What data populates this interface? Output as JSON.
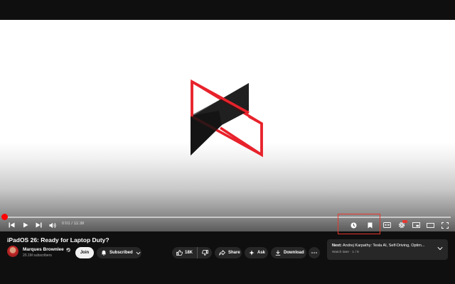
{
  "player": {
    "time_display": "0:01 / 11:38",
    "progress_fraction": 0.005,
    "colors": {
      "accent": "#ff0000",
      "highlight_box": "#e5372b",
      "background": "#0f0f0f"
    },
    "icons": [
      "previous-icon",
      "play-icon",
      "next-icon",
      "volume-icon",
      "watch-later-icon",
      "save-icon",
      "captions-icon",
      "settings-icon",
      "miniplayer-icon",
      "theater-icon",
      "fullscreen-icon"
    ]
  },
  "video": {
    "title": "iPadOS 26: Ready for Laptop Duty?"
  },
  "channel": {
    "name": "Marques Brownlee",
    "subscribers": "20.1M subscribers"
  },
  "actions": {
    "join_label": "Join",
    "subscribed_label": "Subscribed",
    "like_count": "18K",
    "share_label": "Share",
    "ask_label": "Ask",
    "download_label": "Download"
  },
  "next_up": {
    "prefix": "Next:",
    "title": "Andrej Karpathy: Tesla AI, Self-Driving, Optim...",
    "playlist": "Watch later · 1 / 8"
  }
}
